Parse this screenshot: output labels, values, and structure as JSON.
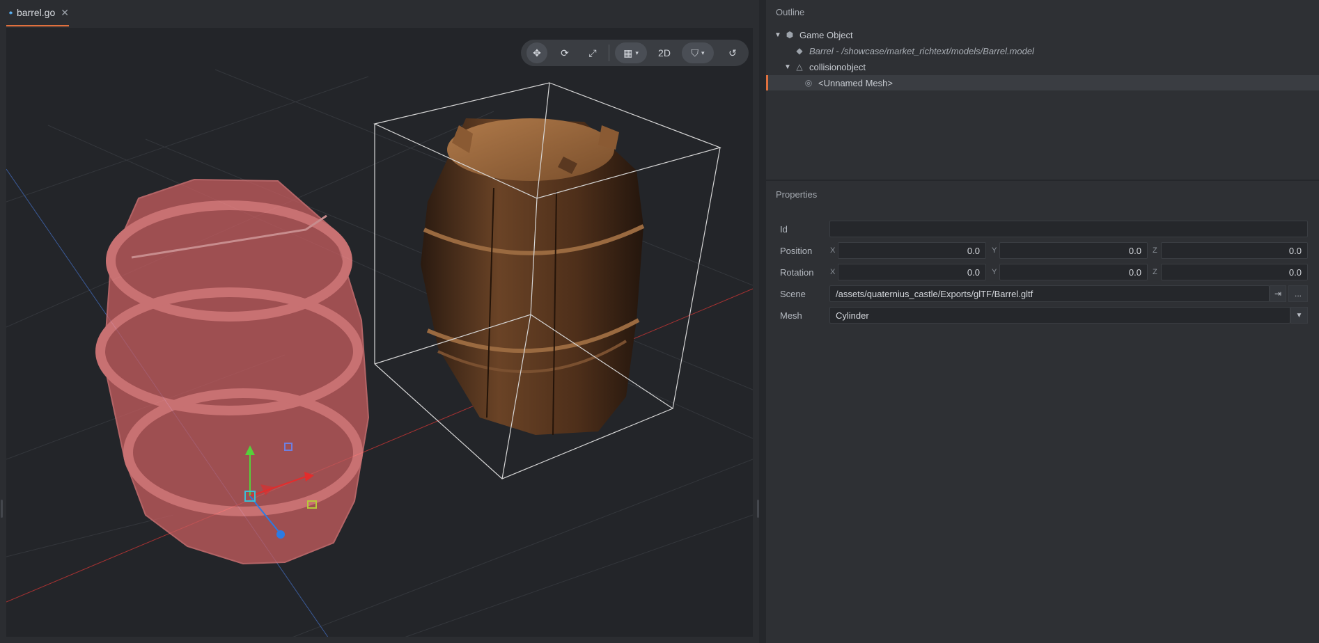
{
  "tab": {
    "label": "barrel.go",
    "close": "✕"
  },
  "toolbar": {
    "move": "✥",
    "rotate": "⟳",
    "scale": "⤢",
    "grid": "▦",
    "mode_2d": "2D",
    "camera": "⛉",
    "reset": "↺",
    "caret": "▾"
  },
  "outline": {
    "title": "Outline",
    "items": [
      {
        "label": "Game Object",
        "icon": "cube-icon"
      },
      {
        "label": "Barrel - /showcase/market_richtext/models/Barrel.model",
        "icon": "model-icon"
      },
      {
        "label": "collisionobject",
        "icon": "collision-icon"
      },
      {
        "label": "<Unnamed Mesh>",
        "icon": "mesh-icon"
      }
    ]
  },
  "properties": {
    "title": "Properties",
    "id": {
      "label": "Id",
      "value": ""
    },
    "position": {
      "label": "Position",
      "x": "0.0",
      "y": "0.0",
      "z": "0.0"
    },
    "rotation": {
      "label": "Rotation",
      "x": "0.0",
      "y": "0.0",
      "z": "0.0"
    },
    "axes": {
      "x": "X",
      "y": "Y",
      "z": "Z"
    },
    "scene": {
      "label": "Scene",
      "value": "/assets/quaternius_castle/Exports/glTF/Barrel.gltf",
      "open": "⇥",
      "browse": "..."
    },
    "mesh": {
      "label": "Mesh",
      "value": "Cylinder",
      "caret": "▼"
    }
  },
  "colors": {
    "accent": "#e0703e",
    "collision": "#ff6b6b"
  }
}
